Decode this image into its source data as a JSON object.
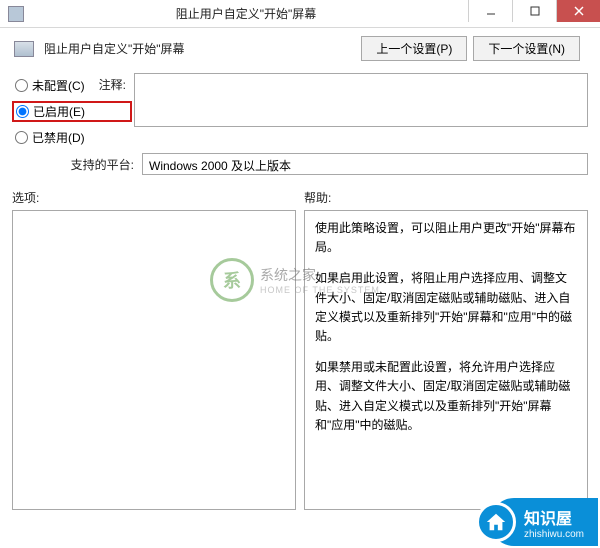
{
  "titlebar": {
    "title": "阻止用户自定义\"开始\"屏幕"
  },
  "header": {
    "title": "阻止用户自定义\"开始\"屏幕",
    "prev_btn": "上一个设置(P)",
    "next_btn": "下一个设置(N)"
  },
  "radios": {
    "not_configured": "未配置(C)",
    "enabled": "已启用(E)",
    "disabled": "已禁用(D)"
  },
  "fields": {
    "comment_label": "注释:",
    "comment_value": "",
    "platform_label": "支持的平台:",
    "platform_value": "Windows 2000 及以上版本"
  },
  "lower": {
    "options_label": "选项:",
    "help_label": "帮助:",
    "help_paragraphs": [
      "使用此策略设置，可以阻止用户更改\"开始\"屏幕布局。",
      "如果启用此设置，将阻止用户选择应用、调整文件大小、固定/取消固定磁贴或辅助磁贴、进入自定义模式以及重新排列\"开始\"屏幕和\"应用\"中的磁贴。",
      "如果禁用或未配置此设置，将允许用户选择应用、调整文件大小、固定/取消固定磁贴或辅助磁贴、进入自定义模式以及重新排列\"开始\"屏幕和\"应用\"中的磁贴。"
    ]
  },
  "watermark": {
    "main": "系统之家",
    "sub": "HOME OF THE SYSTEM"
  },
  "badge": {
    "cn": "知识屋",
    "url": "zhishiwu.com"
  }
}
